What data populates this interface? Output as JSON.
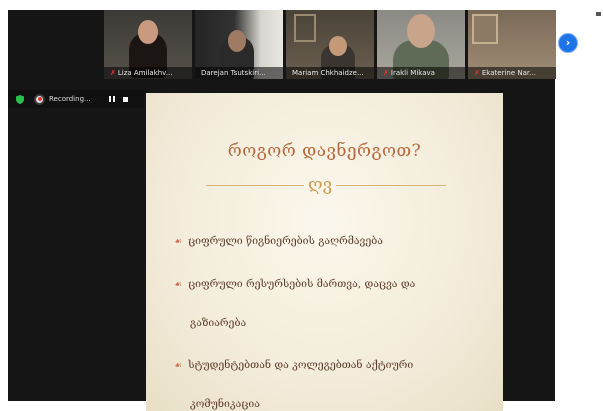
{
  "participants": [
    {
      "name": "Liza Amilakhv...",
      "muted": true
    },
    {
      "name": "Darejan Tsutskiri...",
      "muted": false
    },
    {
      "name": "Mariam Chkhaidze...",
      "muted": false
    },
    {
      "name": "Irakli Mikava",
      "muted": true
    },
    {
      "name": "Ekaterine Nar...",
      "muted": true
    }
  ],
  "recording": {
    "label": "Recording..."
  },
  "slide": {
    "title": "როგორ დავნერგოთ?",
    "ornament": "ღვ",
    "bullet_mark": "☙",
    "bullets": [
      {
        "line1": "ციფრული წიგნიერების გაღრმავება"
      },
      {
        "line1": "ციფრული რესურსების მართვა, დაცვა და",
        "line2": "გაზიარება"
      },
      {
        "line1": "სტუდენტებთან და კოლეგებთან აქტიური",
        "line2": "კომუნიკაცია"
      }
    ]
  },
  "controls": {
    "next_symbol": "›"
  },
  "colors": {
    "slide_title": "#b46a3c",
    "bullet_text": "#5d3b2a",
    "accent": "#1d74e8",
    "muted_icon": "#e33333"
  },
  "icons": [
    "shield-icon",
    "record-icon",
    "pause-icon",
    "stop-icon",
    "mic-muted-icon",
    "next-arrow-icon",
    "ornament-icon"
  ]
}
